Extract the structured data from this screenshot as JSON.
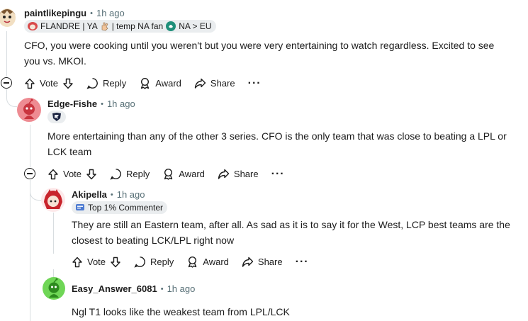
{
  "comments": [
    {
      "username": "paintlikepingu",
      "time": "1h ago",
      "flair": {
        "text1": "FLANDRE | YA",
        "text2": "| temp NA fan",
        "text3": "NA > EU"
      },
      "body_lines": [
        "CFO, you were cooking until you weren't but you were very entertaining to watch regardless. Excited to see",
        "you vs. MKOI."
      ],
      "actions": {
        "vote": "Vote",
        "reply": "Reply",
        "award": "Award",
        "share": "Share",
        "more": "···"
      }
    },
    {
      "username": "Edge-Fishe",
      "time": "1h ago",
      "body_lines": [
        "More entertaining than any of the other 3 series. CFO is the only team that was close to beating a LPL or",
        "LCK team"
      ],
      "actions": {
        "vote": "Vote",
        "reply": "Reply",
        "award": "Award",
        "share": "Share",
        "more": "···"
      }
    },
    {
      "username": "Akipella",
      "time": "1h ago",
      "flair": {
        "text": "Top 1% Commenter"
      },
      "body_lines": [
        "They are still an Eastern team, after all. As sad as it is to say it for the West, LCP best teams are the",
        "closest to beating LCK/LPL right now"
      ],
      "actions": {
        "vote": "Vote",
        "reply": "Reply",
        "award": "Award",
        "share": "Share",
        "more": "···"
      }
    },
    {
      "username": "Easy_Answer_6081",
      "time": "1h ago",
      "body_lines": [
        "Ngl T1 looks like the weakest team from LPL/LCK"
      ]
    }
  ],
  "colors": {
    "meta_gray": "#576f76",
    "thread_line": "#d8dde0",
    "flair_bg": "#eaedef",
    "edge_avatar": "#ee8b92",
    "easy_avatar": "#6fd656"
  },
  "icons": [
    "upvote-icon",
    "downvote-icon",
    "reply-bubble-icon",
    "award-icon",
    "share-icon",
    "collapse-icon",
    "team-logo-icon",
    "commenter-badge-icon"
  ]
}
